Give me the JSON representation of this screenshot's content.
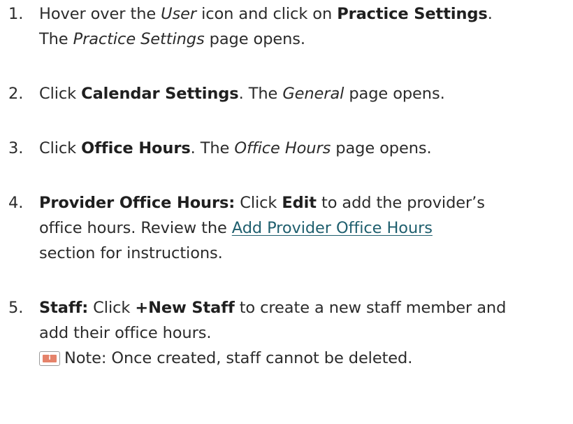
{
  "steps": [
    {
      "number": "1.",
      "line1": {
        "t1": "Hover over the ",
        "i1": "User",
        "t2": " icon and click on ",
        "b1": "Practice Settings",
        "t3": "."
      },
      "line2": {
        "t1": "The ",
        "i1": "Practice Settings",
        "t2": " page opens."
      }
    },
    {
      "number": "2.",
      "line1": {
        "t1": "Click ",
        "b1": "Calendar Settings",
        "t2": ". The ",
        "i1": "General",
        "t3": " page opens."
      }
    },
    {
      "number": "3.",
      "line1": {
        "t1": "Click ",
        "b1": "Office Hours",
        "t2": ". The ",
        "i1": "Office Hours",
        "t3": " page opens."
      }
    },
    {
      "number": "4.",
      "line1": {
        "b1": "Provider Office Hours:",
        "t1": " Click ",
        "b2": "Edit",
        "t2": " to add the provider’s"
      },
      "line2": {
        "t1": "office hours. Review the ",
        "link": "Add Provider Office Hours"
      },
      "line3": {
        "t1": "section for instructions."
      }
    },
    {
      "number": "5.",
      "line1": {
        "b1": "Staff:",
        "t1": " Click ",
        "b2": "+New Staff",
        "t2": " to create a new staff member and"
      },
      "line2": {
        "t1": "add their office hours."
      },
      "note": {
        "icon": "info-icon",
        "icon_glyph": "i",
        "icon_color": "#e5826a",
        "text": "Note: Once created, staff cannot be deleted."
      }
    }
  ]
}
